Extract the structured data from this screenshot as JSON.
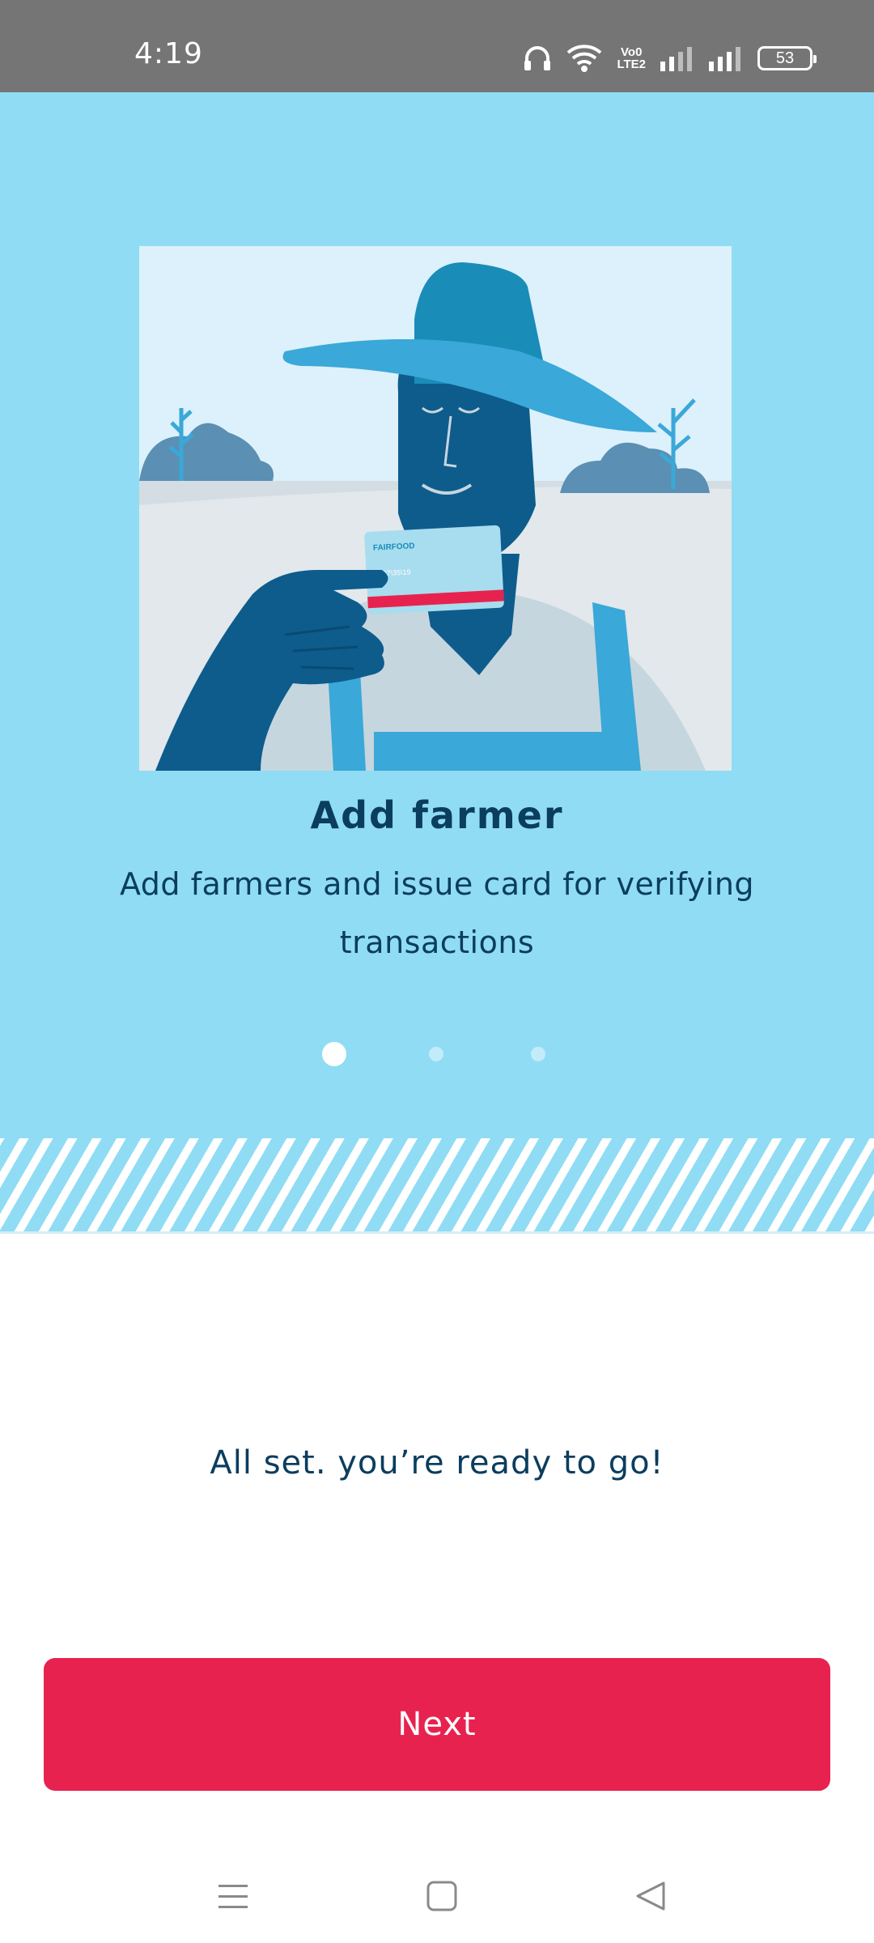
{
  "status_bar": {
    "time": "4:19",
    "volte_line1": "Vo0",
    "volte_line2": "LTE2",
    "battery": "53",
    "icons": [
      "headphones-icon",
      "wifi-icon",
      "volte-icon",
      "signal-icon",
      "signal-icon",
      "battery-icon"
    ]
  },
  "onboarding": {
    "illustration": "farmer-holding-card-illustration",
    "title": "Add farmer",
    "description": "Add farmers and issue card for verifying transactions",
    "dots": {
      "count": 3,
      "active_index": 0
    }
  },
  "ready_text": "All set. you’re ready to go!",
  "next_button_label": "Next",
  "colors": {
    "hero_background": "#90dcf5",
    "title_text": "#0b3d5e",
    "button": "#e8224f",
    "status_bar": "#757575"
  },
  "nav_bar": {
    "items": [
      "menu-icon",
      "home-icon",
      "back-icon"
    ]
  }
}
